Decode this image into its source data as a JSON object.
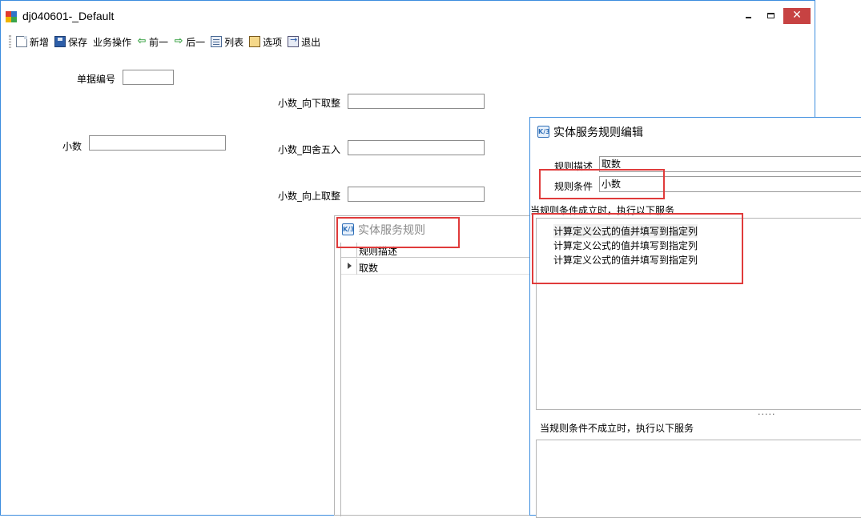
{
  "main_window": {
    "title": "dj040601-_Default",
    "controls": {
      "minimize": "–",
      "maximize": "□",
      "close": "✕"
    },
    "toolbar": {
      "items": [
        {
          "label": "新增",
          "icon": "new-document-icon"
        },
        {
          "label": "保存",
          "icon": "save-icon"
        },
        {
          "label": "业务操作",
          "icon": ""
        },
        {
          "label": "前一",
          "icon": "arrow-left-icon"
        },
        {
          "label": "后一",
          "icon": "arrow-right-icon"
        },
        {
          "label": "列表",
          "icon": "list-icon"
        },
        {
          "label": "选项",
          "icon": "options-icon"
        },
        {
          "label": "退出",
          "icon": "exit-icon"
        }
      ]
    },
    "form": {
      "doc_number_label": "单据编号",
      "decimal_label": "小数",
      "floor_label": "小数_向下取整",
      "round_label": "小数_四舍五入",
      "ceil_label": "小数_向上取整"
    }
  },
  "rules_dialog": {
    "title": "实体服务规则",
    "grid": {
      "column": "规则描述",
      "rows": [
        "取数"
      ]
    }
  },
  "edit_dialog": {
    "title": "实体服务规则编辑",
    "desc_label": "规则描述",
    "desc_value": "取数",
    "cond_label": "规则条件",
    "cond_value": "小数",
    "true_section_label": "当规则条件成立时，执行以下服务",
    "true_services": [
      "计算定义公式的值并填写到指定列",
      "计算定义公式的值并填写到指定列",
      "计算定义公式的值并填写到指定列"
    ],
    "splitter": "·····",
    "false_section_label": "当规则条件不成立时，执行以下服务"
  },
  "colors": {
    "window_border": "#3c8dde",
    "close_button": "#c74242",
    "highlight_box": "#e03b3b"
  }
}
